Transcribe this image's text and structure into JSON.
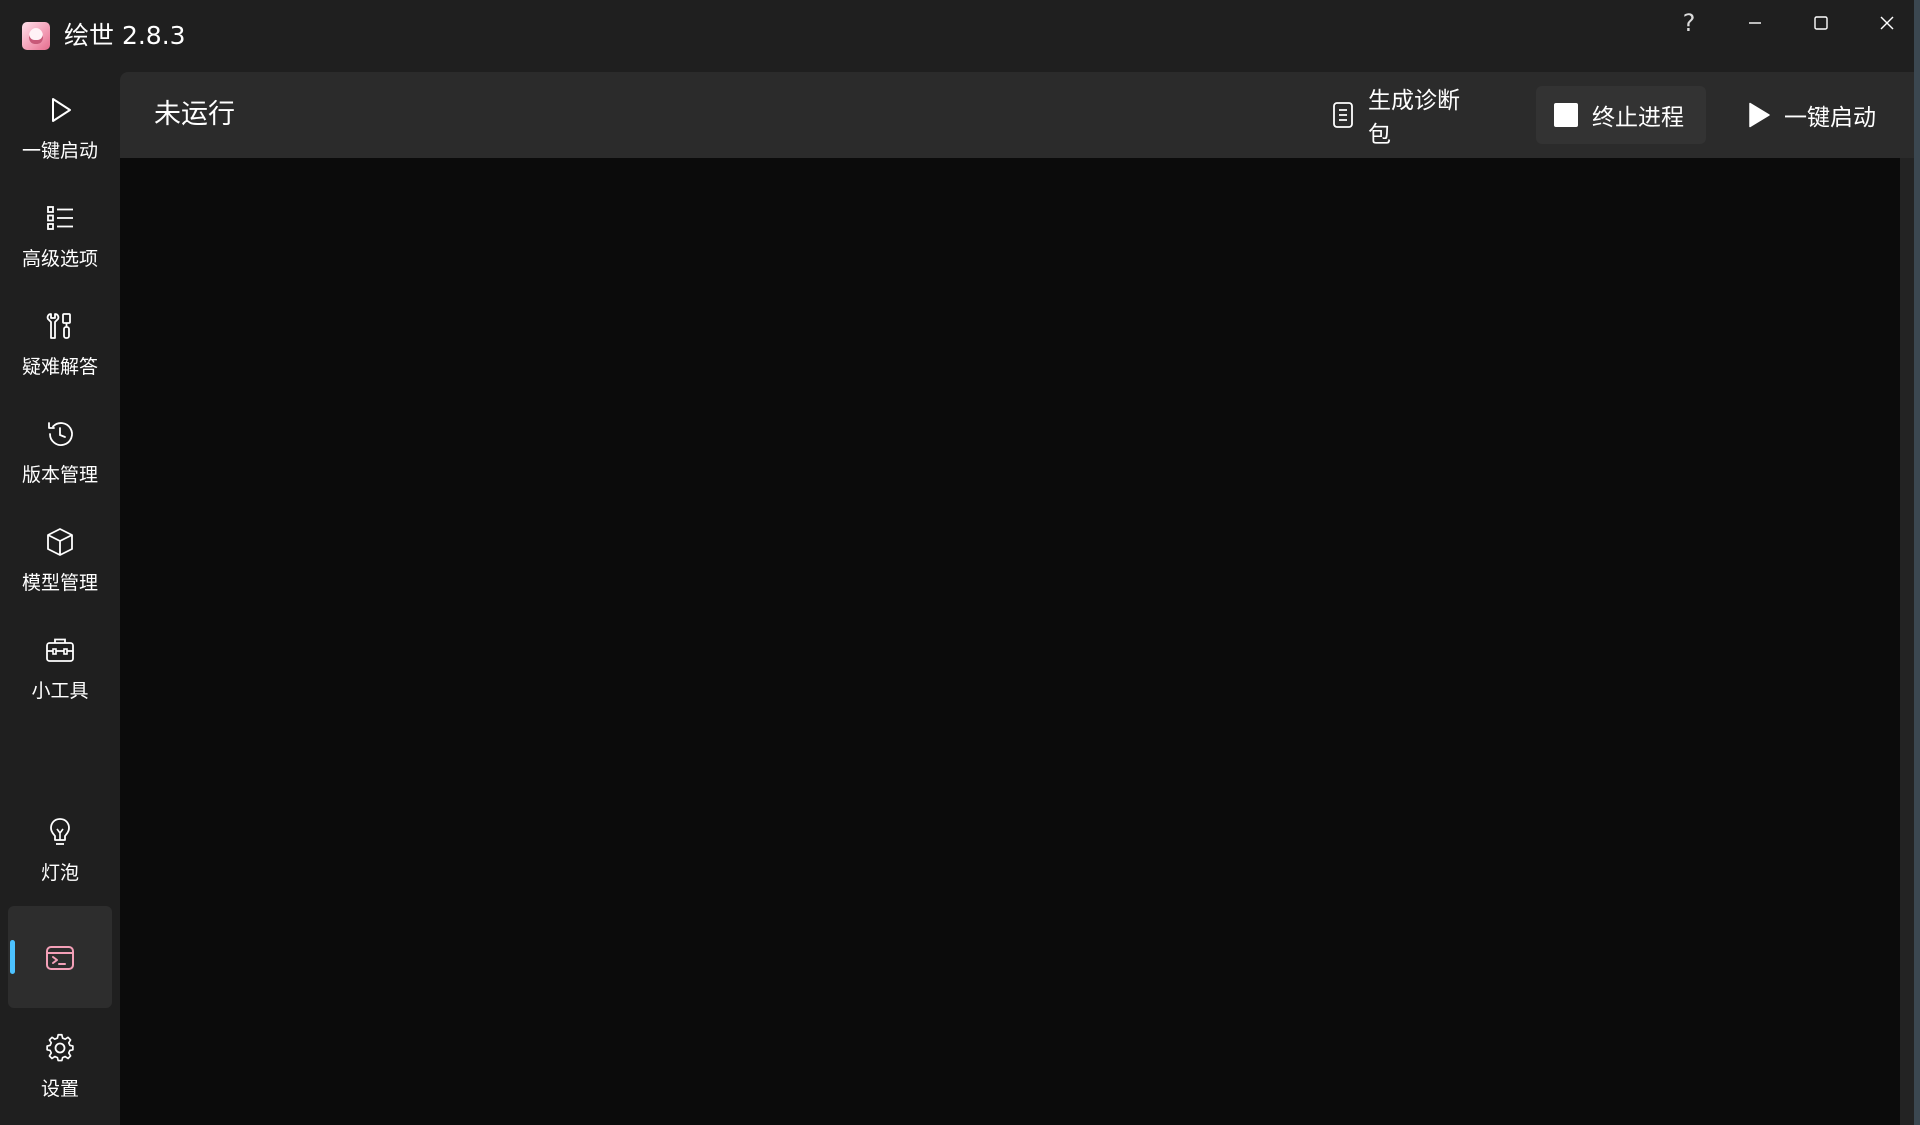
{
  "window": {
    "title": "绘世 2.8.3",
    "controls": {
      "help": "?"
    }
  },
  "sidebar": {
    "items": [
      {
        "label": "一键启动",
        "icon": "play-outline-icon"
      },
      {
        "label": "高级选项",
        "icon": "list-icon"
      },
      {
        "label": "疑难解答",
        "icon": "tools-icon"
      },
      {
        "label": "版本管理",
        "icon": "history-icon"
      },
      {
        "label": "模型管理",
        "icon": "cube-icon"
      },
      {
        "label": "小工具",
        "icon": "toolbox-icon"
      },
      {
        "label": "灯泡",
        "icon": "lightbulb-icon"
      }
    ],
    "active": {
      "icon": "console-icon",
      "accent": "#f4a0b8",
      "indicator": "#4cc2ff"
    },
    "settings": {
      "label": "设置",
      "icon": "gear-icon"
    }
  },
  "header": {
    "status": "未运行",
    "diag_label": "生成诊断包",
    "stop_label": "终止进程",
    "launch_label": "一键启动"
  },
  "colors": {
    "background": "#1f1f1f",
    "header": "#2b2b2b",
    "console": "#0b0b0b",
    "accent": "#4cc2ff"
  }
}
